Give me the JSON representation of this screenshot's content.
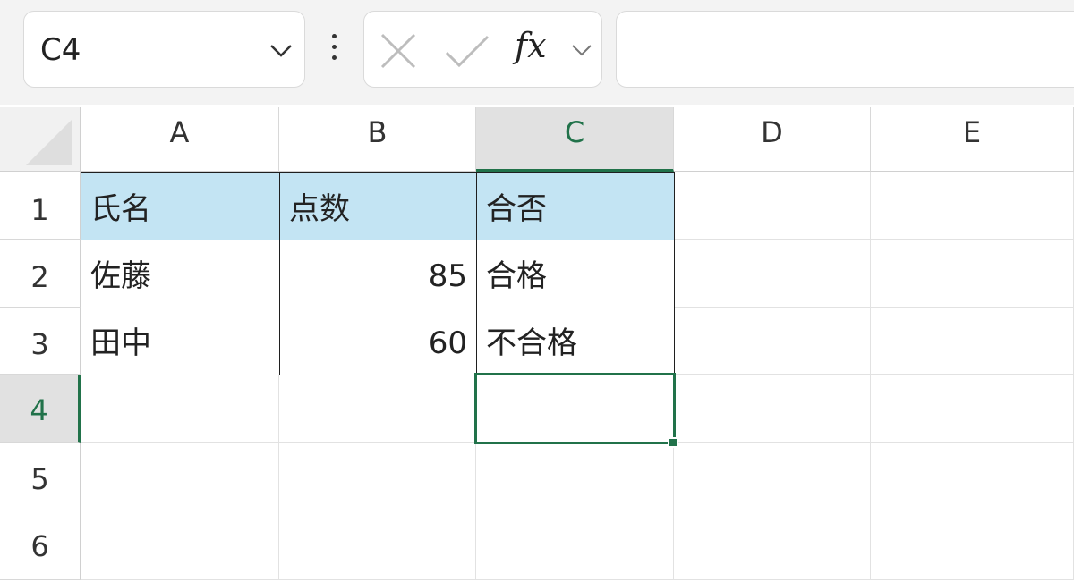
{
  "name_box": {
    "value": "C4"
  },
  "formula_bar": {
    "fx_label": "fx",
    "formula": ""
  },
  "columns": [
    "A",
    "B",
    "C",
    "D",
    "E"
  ],
  "rows": [
    "1",
    "2",
    "3",
    "4",
    "5",
    "6"
  ],
  "selected_cell": {
    "column": "C",
    "row": "4"
  },
  "cells": {
    "A1": "氏名",
    "B1": "点数",
    "C1": "合否",
    "A2": "佐藤",
    "B2": "85",
    "C2": "合格",
    "A3": "田中",
    "B3": "60",
    "C3": "不合格"
  },
  "colors": {
    "header_fill": "#c3e4f3",
    "selection": "#21724a"
  }
}
